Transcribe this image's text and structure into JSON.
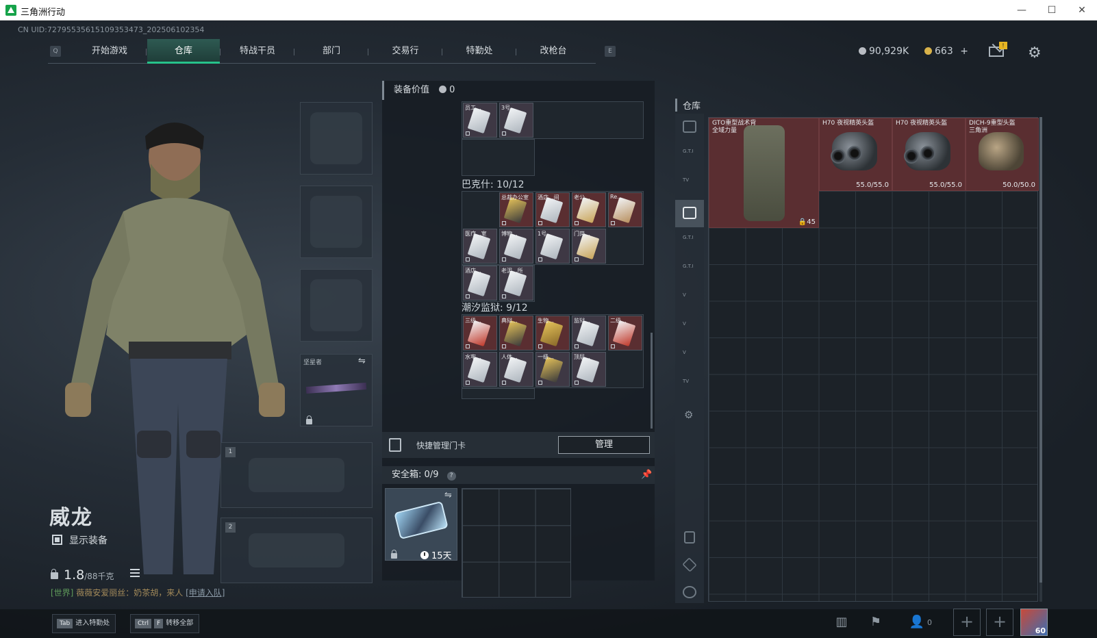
{
  "window": {
    "title": "三角洲行动",
    "minimize": "—",
    "maximize": "☐",
    "close": "✕"
  },
  "uid": "CN UID:727955356151093534​73_20250​6102354",
  "nav": {
    "left_key": "Q",
    "right_key": "E",
    "tabs": [
      "开始游戏",
      "仓库",
      "特战干员",
      "部门",
      "交易行",
      "特勤处",
      "改枪台"
    ],
    "active_index": 1
  },
  "currency": {
    "silver": "90,929K",
    "gold": "663",
    "gold_add": "+",
    "silver_color": "#b8bcc2",
    "gold_color": "#d8b24a"
  },
  "mail_badge": "!",
  "character": {
    "name": "威龙",
    "show_equipment": "显示装备",
    "weight_value": "1.8",
    "weight_unit": "/88千克",
    "chat_channel": "[世界]",
    "chat_user": "薇薇安爱丽丝",
    "chat_text": "：奶茶胡，来人",
    "chat_link": "[申请入队]"
  },
  "slots": {
    "melee_label": "坚星者",
    "primary_num": "1",
    "secondary_num": "2"
  },
  "middle": {
    "equip_value_label": "装备价值",
    "equip_value": "0",
    "top_cards": [
      "员工...",
      "3号..."
    ],
    "section1_title": "巴克什: 10/12",
    "section1_cards": [
      "总裁办公室",
      "酒店...间",
      "老公...",
      "Re...",
      "医疗...室",
      "博物...",
      "1号...",
      "门岗...",
      "酒店...",
      "老泥...所"
    ],
    "section2_title": "潮汐监狱: 9/12",
    "section2_cards": [
      "三级...",
      "典狱...",
      "生物...",
      "监狱...",
      "二级...",
      "水牢...",
      "人体...",
      "一级...",
      "顶层..."
    ],
    "quick_card_label": "快捷管理门卡",
    "manage_button": "管理",
    "safe_label": "安全箱:",
    "safe_count": "0",
    "safe_total": "/9",
    "safe_help": "?",
    "safe_days": "15天"
  },
  "stash": {
    "title": "仓库",
    "side_tabs": [
      "",
      "G.T.I",
      "TV",
      "G.T.I",
      "G.T.I",
      "G.T.I",
      "V",
      "V",
      "V",
      "TV"
    ],
    "items": [
      {
        "name": "GTO重型战术背",
        "sub": "全域力量",
        "count": "45"
      },
      {
        "name": "H70 夜视精英头盔",
        "durability": "55.0/55.0"
      },
      {
        "name": "H70 夜视精英头盔",
        "durability": "55.0/55.0"
      },
      {
        "name": "DICH-9重型头盔",
        "sub": "三角洲",
        "durability": "50.0/50.0"
      }
    ]
  },
  "bottom": {
    "hotkey1_key": "Tab",
    "hotkey1_label": "进入特勤处",
    "hotkey2_key1": "Ctrl",
    "hotkey2_key2": "F",
    "hotkey2_label": "转移全部",
    "friends": "0",
    "avatar_level": "60"
  }
}
